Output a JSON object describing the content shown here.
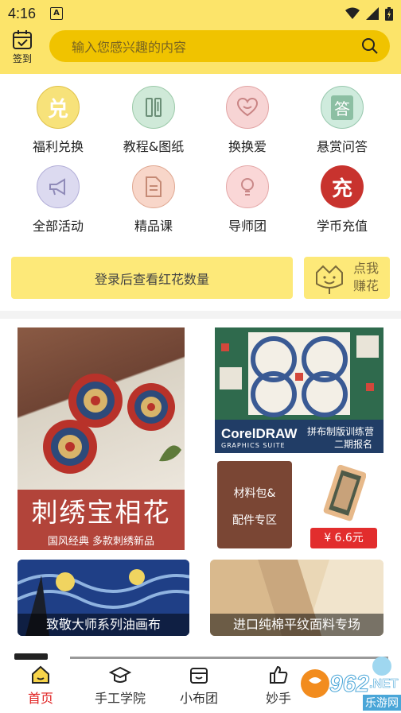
{
  "status": {
    "time": "4:16",
    "notif_badge": "A"
  },
  "header": {
    "checkin_label": "签到",
    "search_placeholder": "输入您感兴趣的内容"
  },
  "grid": [
    {
      "label": "福利兑换",
      "icon": "exchange-icon",
      "glyph": "兑",
      "bg": "#F7E27A"
    },
    {
      "label": "教程&图纸",
      "icon": "ruler-icon",
      "bg": "#CFE9D8"
    },
    {
      "label": "换换爱",
      "icon": "heart-icon",
      "bg": "#F7D4D4"
    },
    {
      "label": "悬赏问答",
      "icon": "answer-icon",
      "glyph": "答",
      "bg": "#CFEBDD"
    },
    {
      "label": "全部活动",
      "icon": "megaphone-icon",
      "bg": "#DCDAF0"
    },
    {
      "label": "精品课",
      "icon": "document-icon",
      "bg": "#F8D6C9"
    },
    {
      "label": "导师团",
      "icon": "lightbulb-icon",
      "bg": "#FAD7D7"
    },
    {
      "label": "学币充值",
      "icon": "recharge-icon",
      "glyph": "充",
      "bg": "#C8332E"
    }
  ],
  "login_prompt": "登录后查看红花数量",
  "earn": {
    "line1": "点我",
    "line2": "赚花"
  },
  "cards": {
    "embroidery": {
      "title": "刺绣宝相花",
      "subtitle": "国风经典 多款刺绣新品"
    },
    "corel": {
      "brand": "CorelDRAW",
      "suite": "GRAPHICS SUITE",
      "line1": "拼布制版训练营",
      "line2": "二期报名"
    },
    "material": {
      "line1": "材料包&",
      "line2": "配件专区"
    },
    "price": "¥ 6.6元",
    "painting": "致敬大师系列油画布",
    "cotton": "进口纯棉平纹面料专场"
  },
  "tabs": [
    {
      "label": "首页",
      "icon": "home-icon",
      "active": true
    },
    {
      "label": "手工学院",
      "icon": "graduation-cap-icon",
      "active": false
    },
    {
      "label": "小布团",
      "icon": "basket-icon",
      "active": false
    },
    {
      "label": "妙手",
      "icon": "thumbs-up-icon",
      "active": false
    }
  ],
  "watermark": {
    "logo": "962",
    "suffix": ".NET",
    "sub": "乐游网"
  },
  "colors": {
    "brand_yellow": "#FCE46A",
    "search_yellow": "#F0C300",
    "active_red": "#E02020"
  }
}
